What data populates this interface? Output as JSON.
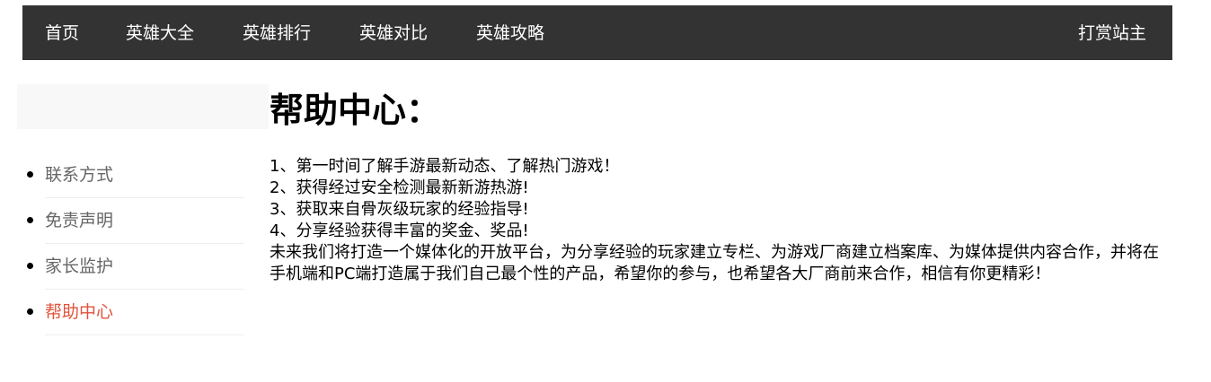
{
  "nav": {
    "items": [
      {
        "label": "首页"
      },
      {
        "label": "英雄大全"
      },
      {
        "label": "英雄排行"
      },
      {
        "label": "英雄对比"
      },
      {
        "label": "英雄攻略"
      }
    ],
    "reward_label": "打赏站主"
  },
  "sidebar": {
    "items": [
      {
        "label": "联系方式",
        "active": false
      },
      {
        "label": "免责声明",
        "active": false
      },
      {
        "label": "家长监护",
        "active": false
      },
      {
        "label": "帮助中心",
        "active": true
      }
    ]
  },
  "main": {
    "title": "帮助中心：",
    "lines": [
      "1、第一时间了解手游最新动态、了解热门游戏！",
      "2、获得经过安全检测最新新游热游!",
      "3、获取来自骨灰级玩家的经验指导!",
      "4、分享经验获得丰富的奖金、奖品!",
      "未来我们将打造一个媒体化的开放平台，为分享经验的玩家建立专栏、为游戏厂商建立档案库、为媒体提供内容合作，并将在手机端和PC端打造属于我们自己最个性的产品，希望你的参与，也希望各大厂商前来合作，相信有你更精彩！"
    ]
  },
  "colors": {
    "nav_background": "#333333",
    "active_link": "#e0533b",
    "sidebar_link": "#666666"
  }
}
